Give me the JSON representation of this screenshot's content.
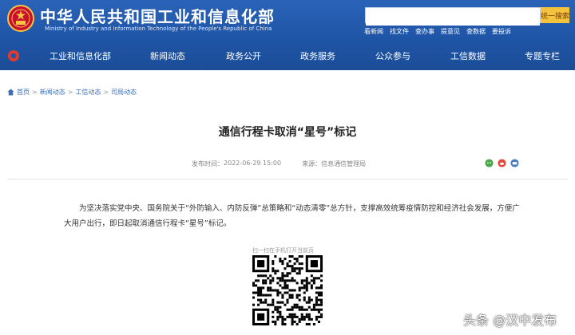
{
  "header": {
    "site_title": "中华人民共和国工业和信息化部",
    "site_subtitle": "Ministry of Industry and Information Technology of the People's Republic of China",
    "search": {
      "placeholder": "",
      "button_label": "统一搜索"
    },
    "quick_links": [
      "看新闻",
      "找文件",
      "查办事",
      "提意见",
      "查数据",
      "要投诉"
    ]
  },
  "nav": {
    "items": [
      "工业和信息化部",
      "新闻动态",
      "政务公开",
      "政务服务",
      "公众参与",
      "工信数据",
      "专题专栏"
    ]
  },
  "breadcrumb": [
    "首页",
    "新闻动态",
    "工信动态",
    "司局动态"
  ],
  "article": {
    "title": "通信行程卡取消“星号”标记",
    "publish_time_label": "发布时间：",
    "publish_time": "2022-06-29 15:00",
    "source_label": "来源：",
    "source": "信息通信管理局",
    "body": "为坚决落实党中央、国务院关于“外防输入、内防反弹”总策略和“动态清零”总方针，支撑高效统筹疫情防控和经济社会发展，方便广大用户出行，即日起取消通信行程卡“星号”标记。",
    "qr_caption": "扫一扫在手机打开当前页"
  },
  "watermark": "头条 @汉中发布",
  "colors": {
    "header_blue": "#1f55a6",
    "search_button": "#f3c33d",
    "link_blue": "#3b6fb8"
  }
}
